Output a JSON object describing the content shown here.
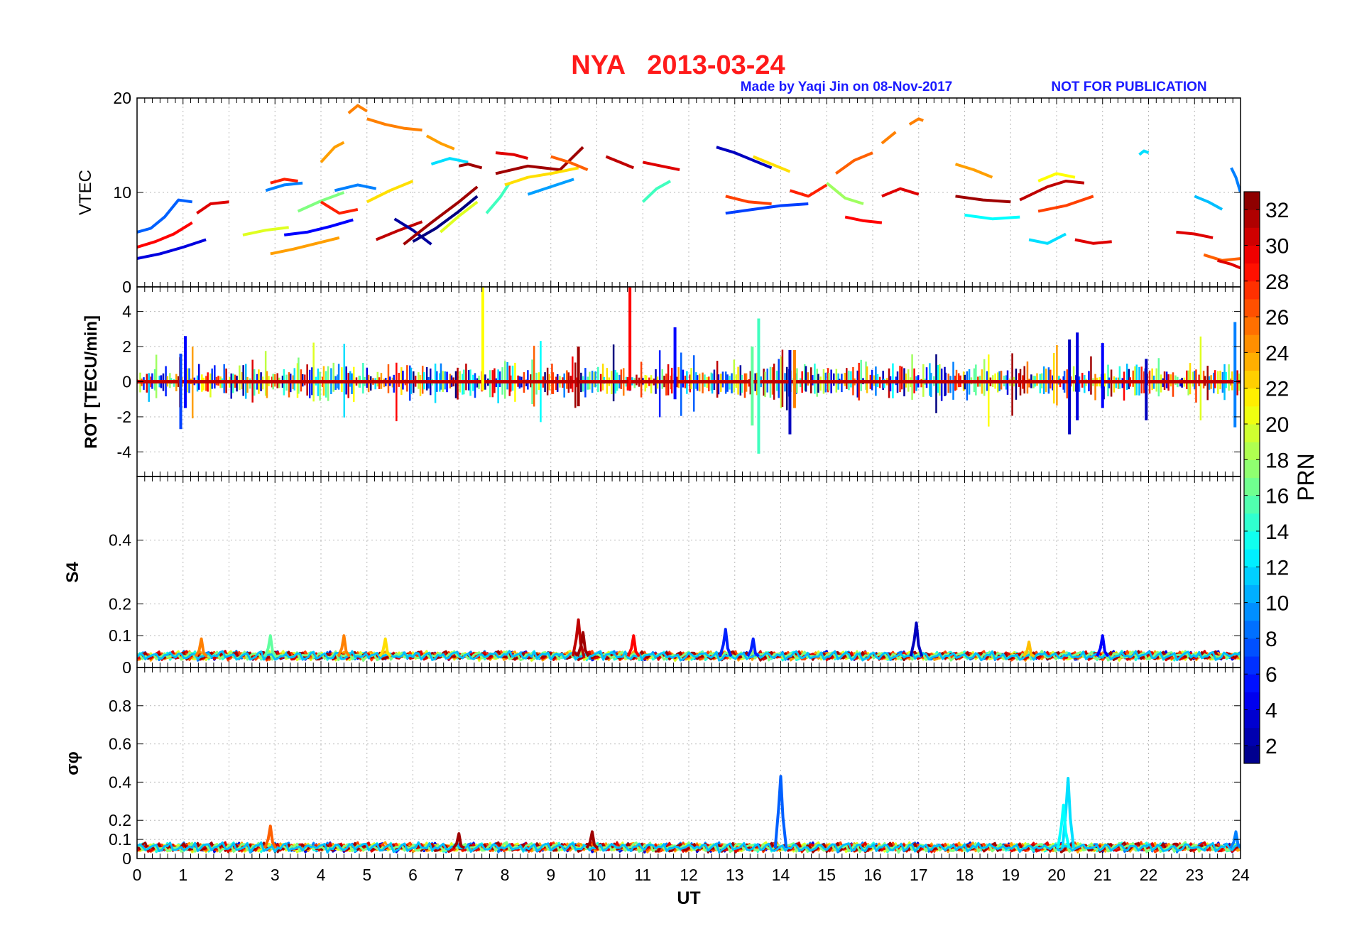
{
  "header": {
    "title": "NYA   2013-03-24",
    "credit": "Made by Yaqi Jin on 08-Nov-2017",
    "notice": "NOT FOR PUBLICATION",
    "title_color": "#ff1a1a",
    "credit_color": "#1a1aff"
  },
  "chart_data": [
    {
      "type": "line",
      "panel": "vtec",
      "ylabel": "VTEC",
      "ylim": [
        0,
        20
      ],
      "yticks": [
        "0",
        "10",
        "20"
      ],
      "xlim": [
        0,
        24
      ],
      "grid": true,
      "series": [
        {
          "prn": 8,
          "x": [
            0.0,
            0.3,
            0.6,
            0.9,
            1.2
          ],
          "y": [
            5.8,
            6.2,
            7.4,
            9.2,
            9.0
          ]
        },
        {
          "prn": 29,
          "x": [
            0.0,
            0.4,
            0.8,
            1.2
          ],
          "y": [
            4.2,
            4.8,
            5.6,
            6.8
          ]
        },
        {
          "prn": 4,
          "x": [
            0.0,
            0.5,
            1.0,
            1.5
          ],
          "y": [
            3.0,
            3.5,
            4.2,
            5.0
          ]
        },
        {
          "prn": 30,
          "x": [
            1.3,
            1.6,
            2.0
          ],
          "y": [
            7.8,
            8.8,
            9.0
          ]
        },
        {
          "prn": 20,
          "x": [
            2.3,
            2.8,
            3.3
          ],
          "y": [
            5.5,
            6.0,
            6.3
          ]
        },
        {
          "prn": 9,
          "x": [
            2.8,
            3.2,
            3.6
          ],
          "y": [
            10.2,
            10.8,
            11.0
          ]
        },
        {
          "prn": 28,
          "x": [
            2.9,
            3.2,
            3.5
          ],
          "y": [
            11.0,
            11.4,
            11.2
          ]
        },
        {
          "prn": 24,
          "x": [
            2.9,
            3.4,
            3.9,
            4.4
          ],
          "y": [
            3.5,
            4.0,
            4.6,
            5.2
          ]
        },
        {
          "prn": 5,
          "x": [
            3.2,
            3.7,
            4.2,
            4.7
          ],
          "y": [
            5.5,
            5.8,
            6.4,
            7.1
          ]
        },
        {
          "prn": 17,
          "x": [
            3.5,
            4.0,
            4.5
          ],
          "y": [
            8.0,
            9.1,
            10.0
          ]
        },
        {
          "prn": 9,
          "x": [
            4.3,
            4.8,
            5.2
          ],
          "y": [
            10.2,
            10.8,
            10.4
          ]
        },
        {
          "prn": 24,
          "x": [
            4.0,
            4.3,
            4.5
          ],
          "y": [
            13.2,
            14.8,
            15.3
          ]
        },
        {
          "prn": 25,
          "x": [
            4.6,
            4.8,
            5.0
          ],
          "y": [
            18.4,
            19.2,
            18.6
          ]
        },
        {
          "prn": 25,
          "x": [
            5.0,
            5.4,
            5.8,
            6.2
          ],
          "y": [
            17.8,
            17.2,
            16.8,
            16.6
          ]
        },
        {
          "prn": 24,
          "x": [
            6.3,
            6.6,
            6.9
          ],
          "y": [
            16.0,
            15.2,
            14.6
          ]
        },
        {
          "prn": 28,
          "x": [
            4.0,
            4.4,
            4.8
          ],
          "y": [
            9.0,
            7.8,
            8.2
          ]
        },
        {
          "prn": 22,
          "x": [
            5.0,
            5.5,
            6.0
          ],
          "y": [
            9.0,
            10.2,
            11.2
          ]
        },
        {
          "prn": 31,
          "x": [
            5.2,
            5.7,
            6.2
          ],
          "y": [
            5.0,
            6.0,
            6.9
          ]
        },
        {
          "prn": 2,
          "x": [
            5.6,
            6.0,
            6.4
          ],
          "y": [
            7.2,
            6.0,
            4.5
          ]
        },
        {
          "prn": 32,
          "x": [
            5.8,
            6.4,
            7.0,
            7.4
          ],
          "y": [
            4.5,
            6.8,
            9.0,
            10.6
          ]
        },
        {
          "prn": 1,
          "x": [
            6.0,
            6.5,
            7.0,
            7.4
          ],
          "y": [
            4.8,
            6.2,
            8.0,
            9.6
          ]
        },
        {
          "prn": 20,
          "x": [
            6.6,
            7.0,
            7.4
          ],
          "y": [
            5.8,
            7.5,
            9.0
          ]
        },
        {
          "prn": 12,
          "x": [
            6.4,
            6.8,
            7.2
          ],
          "y": [
            13.0,
            13.6,
            13.2
          ]
        },
        {
          "prn": 32,
          "x": [
            7.0,
            7.2,
            7.5
          ],
          "y": [
            12.8,
            13.0,
            12.6
          ]
        },
        {
          "prn": 15,
          "x": [
            7.6,
            7.9,
            8.1
          ],
          "y": [
            7.8,
            9.5,
            11.0
          ]
        },
        {
          "prn": 30,
          "x": [
            7.8,
            8.2,
            8.5
          ],
          "y": [
            14.2,
            14.0,
            13.6
          ]
        },
        {
          "prn": 32,
          "x": [
            7.8,
            8.5,
            9.2,
            9.7
          ],
          "y": [
            12.0,
            12.8,
            12.4,
            14.8
          ]
        },
        {
          "prn": 22,
          "x": [
            8.0,
            8.5,
            9.0,
            9.6
          ],
          "y": [
            10.8,
            11.6,
            12.0,
            12.6
          ]
        },
        {
          "prn": 10,
          "x": [
            8.5,
            9.0,
            9.5
          ],
          "y": [
            9.8,
            10.6,
            11.4
          ]
        },
        {
          "prn": 26,
          "x": [
            9.0,
            9.4,
            9.8
          ],
          "y": [
            13.8,
            13.2,
            12.4
          ]
        },
        {
          "prn": 31,
          "x": [
            10.2,
            10.5,
            10.8
          ],
          "y": [
            13.8,
            13.2,
            12.6
          ]
        },
        {
          "prn": 15,
          "x": [
            11.0,
            11.3,
            11.6
          ],
          "y": [
            9.0,
            10.4,
            11.2
          ]
        },
        {
          "prn": 30,
          "x": [
            11.0,
            11.4,
            11.8
          ],
          "y": [
            13.2,
            12.8,
            12.4
          ]
        },
        {
          "prn": 3,
          "x": [
            12.6,
            13.0,
            13.4,
            13.8
          ],
          "y": [
            14.8,
            14.2,
            13.4,
            12.6
          ]
        },
        {
          "prn": 22,
          "x": [
            13.4,
            13.8,
            14.2
          ],
          "y": [
            13.8,
            13.0,
            12.2
          ]
        },
        {
          "prn": 7,
          "x": [
            12.8,
            13.4,
            14.0,
            14.6
          ],
          "y": [
            7.8,
            8.2,
            8.6,
            8.8
          ]
        },
        {
          "prn": 27,
          "x": [
            12.8,
            13.3,
            13.8
          ],
          "y": [
            9.6,
            9.0,
            8.8
          ]
        },
        {
          "prn": 28,
          "x": [
            14.2,
            14.6,
            15.0
          ],
          "y": [
            10.2,
            9.6,
            10.8
          ]
        },
        {
          "prn": 18,
          "x": [
            15.0,
            15.4,
            15.8
          ],
          "y": [
            11.0,
            9.4,
            8.8
          ]
        },
        {
          "prn": 26,
          "x": [
            15.2,
            15.6,
            16.0
          ],
          "y": [
            12.0,
            13.4,
            14.2
          ]
        },
        {
          "prn": 29,
          "x": [
            15.4,
            15.8,
            16.2
          ],
          "y": [
            7.4,
            7.0,
            6.8
          ]
        },
        {
          "prn": 25,
          "x": [
            16.8,
            17.0,
            17.1
          ],
          "y": [
            17.2,
            17.8,
            17.6
          ]
        },
        {
          "prn": 25,
          "x": [
            16.2,
            16.4,
            16.5
          ],
          "y": [
            15.2,
            16.0,
            16.4
          ]
        },
        {
          "prn": 30,
          "x": [
            16.2,
            16.6,
            17.0
          ],
          "y": [
            9.6,
            10.4,
            9.8
          ]
        },
        {
          "prn": 24,
          "x": [
            17.8,
            18.2,
            18.6
          ],
          "y": [
            13.0,
            12.4,
            11.6
          ]
        },
        {
          "prn": 32,
          "x": [
            17.8,
            18.4,
            19.0
          ],
          "y": [
            9.6,
            9.2,
            9.0
          ]
        },
        {
          "prn": 13,
          "x": [
            18.0,
            18.6,
            19.2
          ],
          "y": [
            7.6,
            7.2,
            7.4
          ]
        },
        {
          "prn": 31,
          "x": [
            19.2,
            19.8,
            20.2,
            20.6
          ],
          "y": [
            9.2,
            10.6,
            11.2,
            11.0
          ]
        },
        {
          "prn": 21,
          "x": [
            19.6,
            20.0,
            20.4
          ],
          "y": [
            11.2,
            12.0,
            11.6
          ]
        },
        {
          "prn": 12,
          "x": [
            19.4,
            19.8,
            20.2
          ],
          "y": [
            5.0,
            4.6,
            5.6
          ]
        },
        {
          "prn": 27,
          "x": [
            19.6,
            20.2,
            20.8
          ],
          "y": [
            8.0,
            8.6,
            9.6
          ]
        },
        {
          "prn": 30,
          "x": [
            20.4,
            20.8,
            21.2
          ],
          "y": [
            5.0,
            4.6,
            4.8
          ]
        },
        {
          "prn": 12,
          "x": [
            21.8,
            21.9,
            22.0
          ],
          "y": [
            14.0,
            14.4,
            14.2
          ]
        },
        {
          "prn": 30,
          "x": [
            22.6,
            23.0,
            23.4
          ],
          "y": [
            5.8,
            5.6,
            5.2
          ]
        },
        {
          "prn": 11,
          "x": [
            23.0,
            23.3,
            23.6
          ],
          "y": [
            9.6,
            9.0,
            8.2
          ]
        },
        {
          "prn": 26,
          "x": [
            23.2,
            23.6,
            24.0
          ],
          "y": [
            3.4,
            2.8,
            3.0
          ]
        },
        {
          "prn": 9,
          "x": [
            23.8,
            23.9,
            24.0
          ],
          "y": [
            12.6,
            11.6,
            10.0
          ]
        },
        {
          "prn": 30,
          "x": [
            23.5,
            23.8,
            24.0
          ],
          "y": [
            2.8,
            2.4,
            2.0
          ]
        }
      ]
    },
    {
      "type": "line",
      "panel": "rot",
      "ylabel": "ROT [TECU/min]",
      "ylim": [
        -5.4,
        5.4
      ],
      "yticks": [
        "-4",
        "-2",
        "0",
        "2",
        "4"
      ],
      "xlim": [
        0,
        24
      ],
      "grid": true,
      "spikes": [
        {
          "prn": 7,
          "x": 0.95,
          "ymin": -2.7,
          "ymax": 1.6
        },
        {
          "prn": 5,
          "x": 1.05,
          "ymin": -1.5,
          "ymax": 2.6
        },
        {
          "prn": 21,
          "x": 7.52,
          "ymin": -0.5,
          "ymax": 5.4
        },
        {
          "prn": 29,
          "x": 10.72,
          "ymin": -0.5,
          "ymax": 5.4
        },
        {
          "prn": 32,
          "x": 9.6,
          "ymin": -1.4,
          "ymax": 2.0
        },
        {
          "prn": 5,
          "x": 11.7,
          "ymin": -1.0,
          "ymax": 3.1
        },
        {
          "prn": 15,
          "x": 13.52,
          "ymin": -4.1,
          "ymax": 3.6
        },
        {
          "prn": 16,
          "x": 13.38,
          "ymin": -2.5,
          "ymax": 2.0
        },
        {
          "prn": 3,
          "x": 14.2,
          "ymin": -3.0,
          "ymax": 1.8
        },
        {
          "prn": 25,
          "x": 14.3,
          "ymin": -1.5,
          "ymax": 1.8
        },
        {
          "prn": 3,
          "x": 20.28,
          "ymin": -3.0,
          "ymax": 2.4
        },
        {
          "prn": 4,
          "x": 20.45,
          "ymin": -2.2,
          "ymax": 2.8
        },
        {
          "prn": 9,
          "x": 23.88,
          "ymin": -2.6,
          "ymax": 3.4
        },
        {
          "prn": 5,
          "x": 21.0,
          "ymin": -1.5,
          "ymax": 2.2
        },
        {
          "prn": 3,
          "x": 21.95,
          "ymin": -2.2,
          "ymax": 1.3
        }
      ]
    },
    {
      "type": "line",
      "panel": "s4",
      "ylabel": "S4",
      "ylim": [
        0,
        0.6
      ],
      "yticks": [
        "0",
        "0.1",
        "0.2",
        "0.4"
      ],
      "xlim": [
        0,
        24
      ],
      "grid": true,
      "peaks": [
        {
          "prn": 31,
          "x": 9.6,
          "y": 0.15
        },
        {
          "prn": 32,
          "x": 9.7,
          "y": 0.11
        },
        {
          "prn": 6,
          "x": 12.8,
          "y": 0.12
        },
        {
          "prn": 3,
          "x": 16.95,
          "y": 0.14
        },
        {
          "prn": 16,
          "x": 2.9,
          "y": 0.1
        },
        {
          "prn": 25,
          "x": 1.4,
          "y": 0.09
        },
        {
          "prn": 25,
          "x": 4.5,
          "y": 0.1
        },
        {
          "prn": 22,
          "x": 5.4,
          "y": 0.09
        },
        {
          "prn": 29,
          "x": 10.8,
          "y": 0.1
        },
        {
          "prn": 6,
          "x": 13.4,
          "y": 0.09
        },
        {
          "prn": 5,
          "x": 21.0,
          "y": 0.1
        },
        {
          "prn": 23,
          "x": 19.4,
          "y": 0.08
        }
      ]
    },
    {
      "type": "line",
      "panel": "sigma_phi",
      "ylabel": "σφ",
      "ylim": [
        0,
        1.0
      ],
      "yticks": [
        "0",
        "0.1",
        "0.2",
        "0.4",
        "0.6",
        "0.8"
      ],
      "xlabel": "UT",
      "xlim": [
        0,
        24
      ],
      "xticks": [
        "0",
        "1",
        "2",
        "3",
        "4",
        "5",
        "6",
        "7",
        "8",
        "9",
        "10",
        "11",
        "12",
        "13",
        "14",
        "15",
        "16",
        "17",
        "18",
        "19",
        "20",
        "21",
        "22",
        "23",
        "24"
      ],
      "grid": true,
      "peaks": [
        {
          "prn": 8,
          "x": 14.0,
          "y": 0.43
        },
        {
          "prn": 12,
          "x": 20.25,
          "y": 0.42
        },
        {
          "prn": 13,
          "x": 20.15,
          "y": 0.28
        },
        {
          "prn": 32,
          "x": 7.0,
          "y": 0.13
        },
        {
          "prn": 32,
          "x": 9.9,
          "y": 0.14
        },
        {
          "prn": 9,
          "x": 23.9,
          "y": 0.14
        },
        {
          "prn": 26,
          "x": 2.9,
          "y": 0.17
        }
      ]
    }
  ],
  "colorbar": {
    "label": "PRN",
    "min": 1,
    "max": 33,
    "ticks": [
      "2",
      "4",
      "6",
      "8",
      "10",
      "12",
      "14",
      "16",
      "18",
      "20",
      "22",
      "24",
      "26",
      "28",
      "30",
      "32"
    ],
    "colormap": "jet"
  }
}
